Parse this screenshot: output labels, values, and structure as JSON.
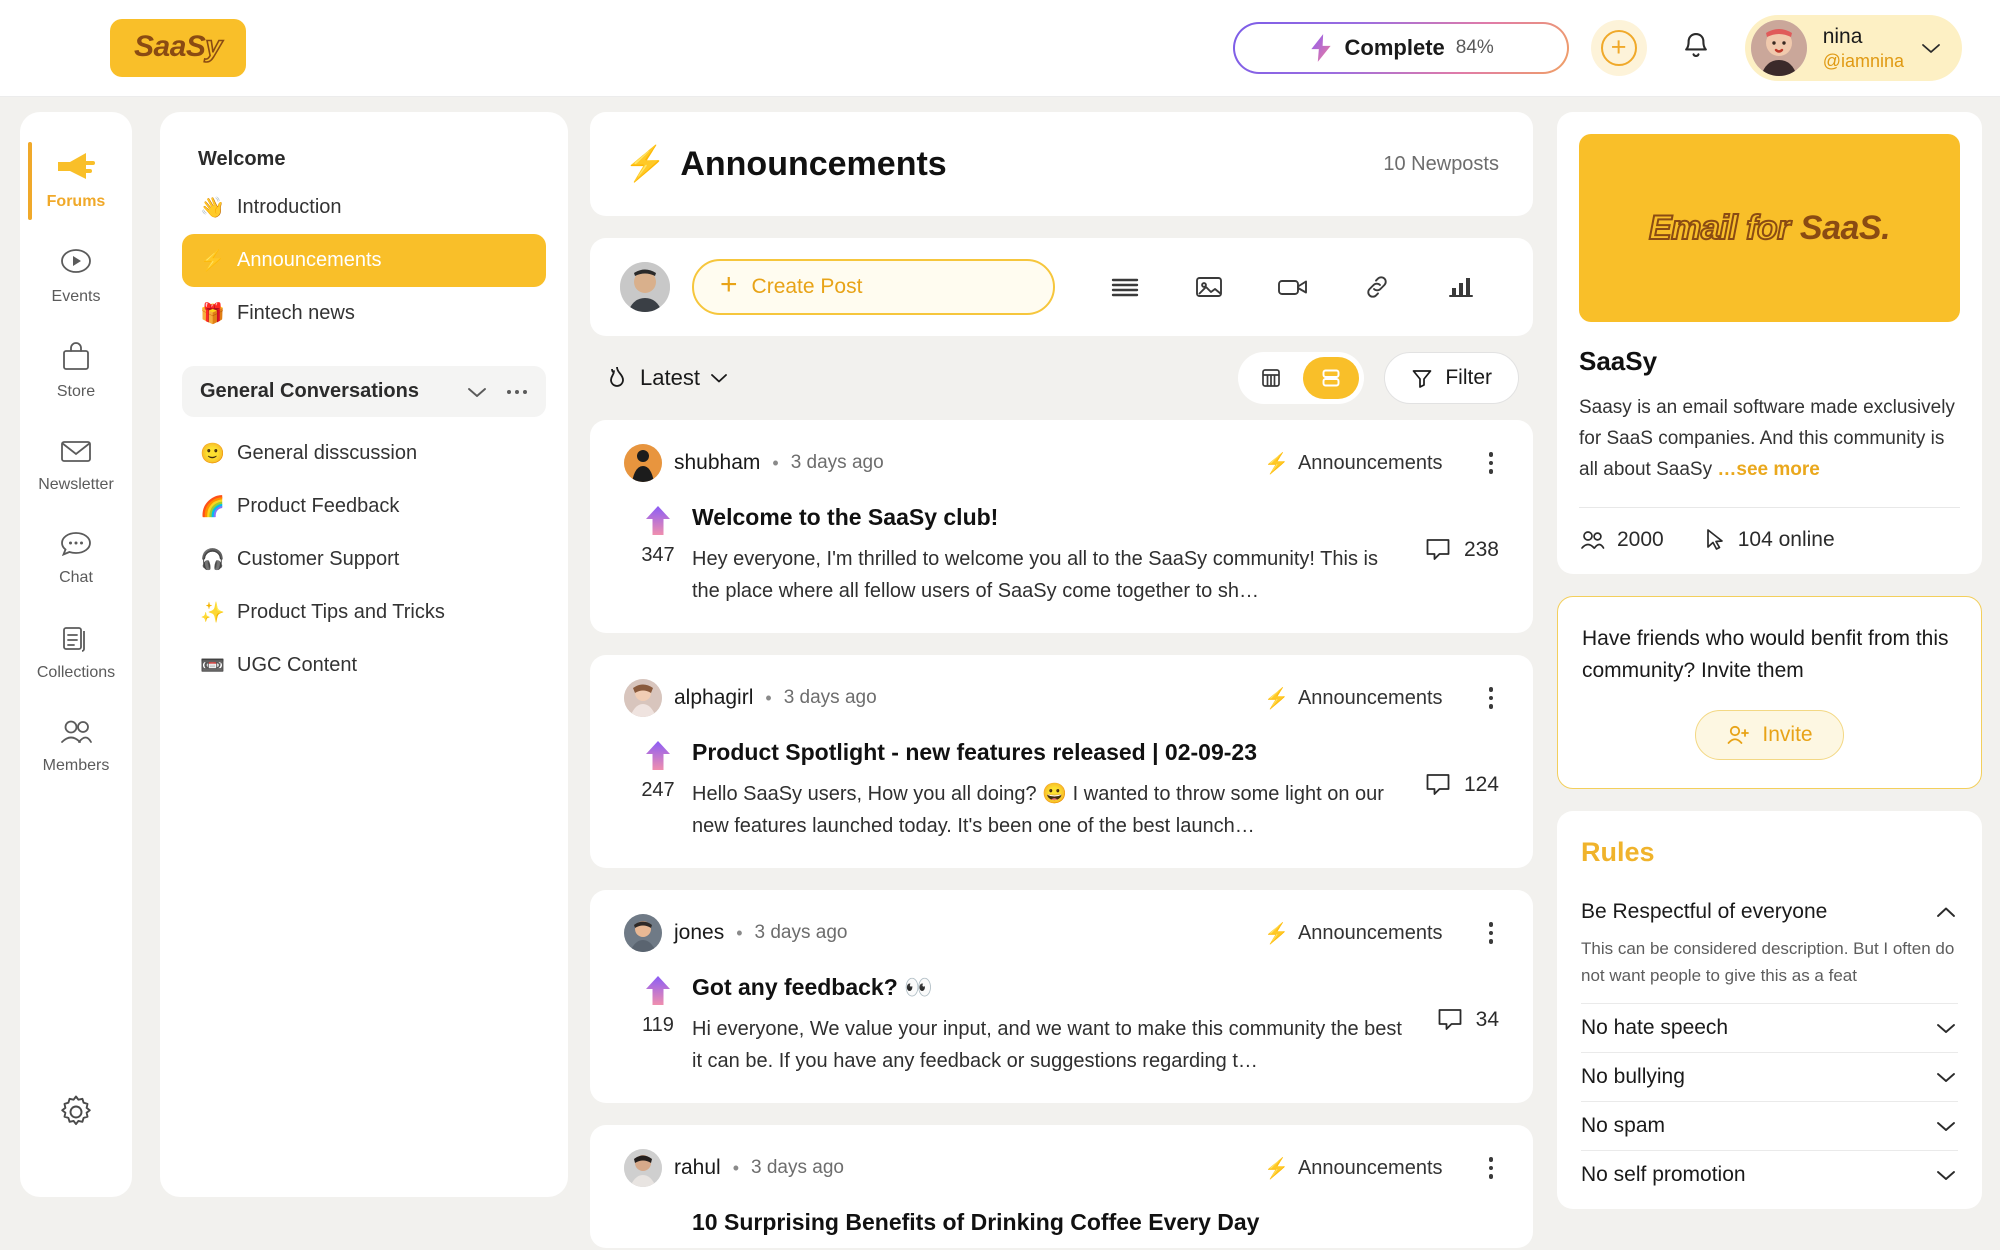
{
  "header": {
    "logo": "SaaS",
    "logo_accent": "y",
    "complete_label": "Complete",
    "complete_percent": "84%",
    "add_icon": "plus-icon",
    "bell_icon": "bell-icon",
    "user_name": "nina",
    "user_handle": "@iamnina",
    "chevron_icon": "chevron-down-icon"
  },
  "rail": {
    "items": [
      {
        "label": "Forums",
        "icon": "megaphone-icon",
        "active": true
      },
      {
        "label": "Events",
        "icon": "play-circle-icon",
        "active": false
      },
      {
        "label": "Store",
        "icon": "bag-icon",
        "active": false
      },
      {
        "label": "Newsletter",
        "icon": "envelope-icon",
        "active": false
      },
      {
        "label": "Chat",
        "icon": "chat-bubble-icon",
        "active": false
      },
      {
        "label": "Collections",
        "icon": "documents-icon",
        "active": false
      },
      {
        "label": "Members",
        "icon": "people-icon",
        "active": false
      }
    ],
    "settings_icon": "gear-icon"
  },
  "channels": {
    "welcome_title": "Welcome",
    "welcome_items": [
      {
        "emoji": "👋",
        "label": "Introduction",
        "active": false
      },
      {
        "emoji": "⚡",
        "label": "Announcements",
        "active": true
      },
      {
        "emoji": "🎁",
        "label": "Fintech news",
        "active": false
      }
    ],
    "group_title": "General Conversations",
    "group_chevron_icon": "chevron-down-icon",
    "group_more_icon": "ellipsis-icon",
    "group_items": [
      {
        "emoji": "🙂",
        "label": "General disscussion"
      },
      {
        "emoji": "🌈",
        "label": "Product Feedback"
      },
      {
        "emoji": "🎧",
        "label": "Customer Support"
      },
      {
        "emoji": "✨",
        "label": "Product Tips and Tricks"
      },
      {
        "emoji": "📼",
        "label": "UGC Content"
      }
    ]
  },
  "feed": {
    "title": "Announcements",
    "title_emoji": "⚡",
    "newposts": "10 Newposts",
    "create_post_label": "Create Post",
    "composer_icons": [
      "text-lines-icon",
      "image-icon",
      "video-icon",
      "link-icon",
      "poll-chart-icon"
    ],
    "sort_label": "Latest",
    "sort_icon": "flame-icon",
    "view_grid_icon": "grid-view-icon",
    "view_list_icon": "list-view-icon",
    "view_active": "list",
    "filter_label": "Filter",
    "filter_icon": "funnel-icon",
    "posts": [
      {
        "author": "shubham",
        "time": "3 days ago",
        "channel": "Announcements",
        "votes": "347",
        "title": "Welcome to the SaaSy club!",
        "excerpt": "Hey everyone, I'm thrilled to welcome you all to the SaaSy community! This is the place where all fellow users of SaaSy come together to sh…",
        "comments": "238"
      },
      {
        "author": "alphagirl",
        "time": "3 days ago",
        "channel": "Announcements",
        "votes": "247",
        "title": "Product Spotlight - new features released | 02-09-23",
        "excerpt": "Hello SaaSy users, How you all doing? 😀 I wanted to throw some light on our new features launched today. It's been one of the best launch…",
        "comments": "124"
      },
      {
        "author": "jones",
        "time": "3 days ago",
        "channel": "Announcements",
        "votes": "119",
        "title": "Got any feedback? 👀",
        "excerpt": "Hi everyone, We value your input, and we want to make this community the best it can be. If you have any feedback or suggestions regarding t…",
        "comments": "34"
      },
      {
        "author": "rahul",
        "time": "3 days ago",
        "channel": "Announcements",
        "votes": "",
        "title": "10 Surprising Benefits of Drinking Coffee Every Day",
        "excerpt": "",
        "comments": ""
      }
    ]
  },
  "rightbar": {
    "banner_text_hollow": "Email for",
    "banner_text_solid": "SaaS.",
    "community_name": "SaaSy",
    "community_desc": "Saasy is an email software made exclusively for SaaS companies. And this community is all about SaaSy",
    "see_more": "…see more",
    "members_count": "2000",
    "members_icon": "people-icon",
    "online_count": "104 online",
    "online_icon": "cursor-icon",
    "invite_text": "Have friends who would benfit from this community? Invite them",
    "invite_button": "Invite",
    "invite_icon": "user-plus-icon",
    "rules_title": "Rules",
    "rules": [
      {
        "title": "Be Respectful of everyone",
        "expanded": true,
        "chevron": "chevron-up-icon",
        "desc": "This can be considered description. But I often do not want people to give this as a feat"
      },
      {
        "title": "No hate speech",
        "expanded": false,
        "chevron": "chevron-down-icon",
        "desc": ""
      },
      {
        "title": "No bullying",
        "expanded": false,
        "chevron": "chevron-down-icon",
        "desc": ""
      },
      {
        "title": "No spam",
        "expanded": false,
        "chevron": "chevron-down-icon",
        "desc": ""
      },
      {
        "title": "No self promotion",
        "expanded": false,
        "chevron": "chevron-down-icon",
        "desc": ""
      }
    ]
  },
  "colors": {
    "brand_yellow": "#f9bf29",
    "brand_amber": "#f0a92a",
    "logo_brown": "#8a4b13",
    "page_bg": "#f2f1ee"
  }
}
